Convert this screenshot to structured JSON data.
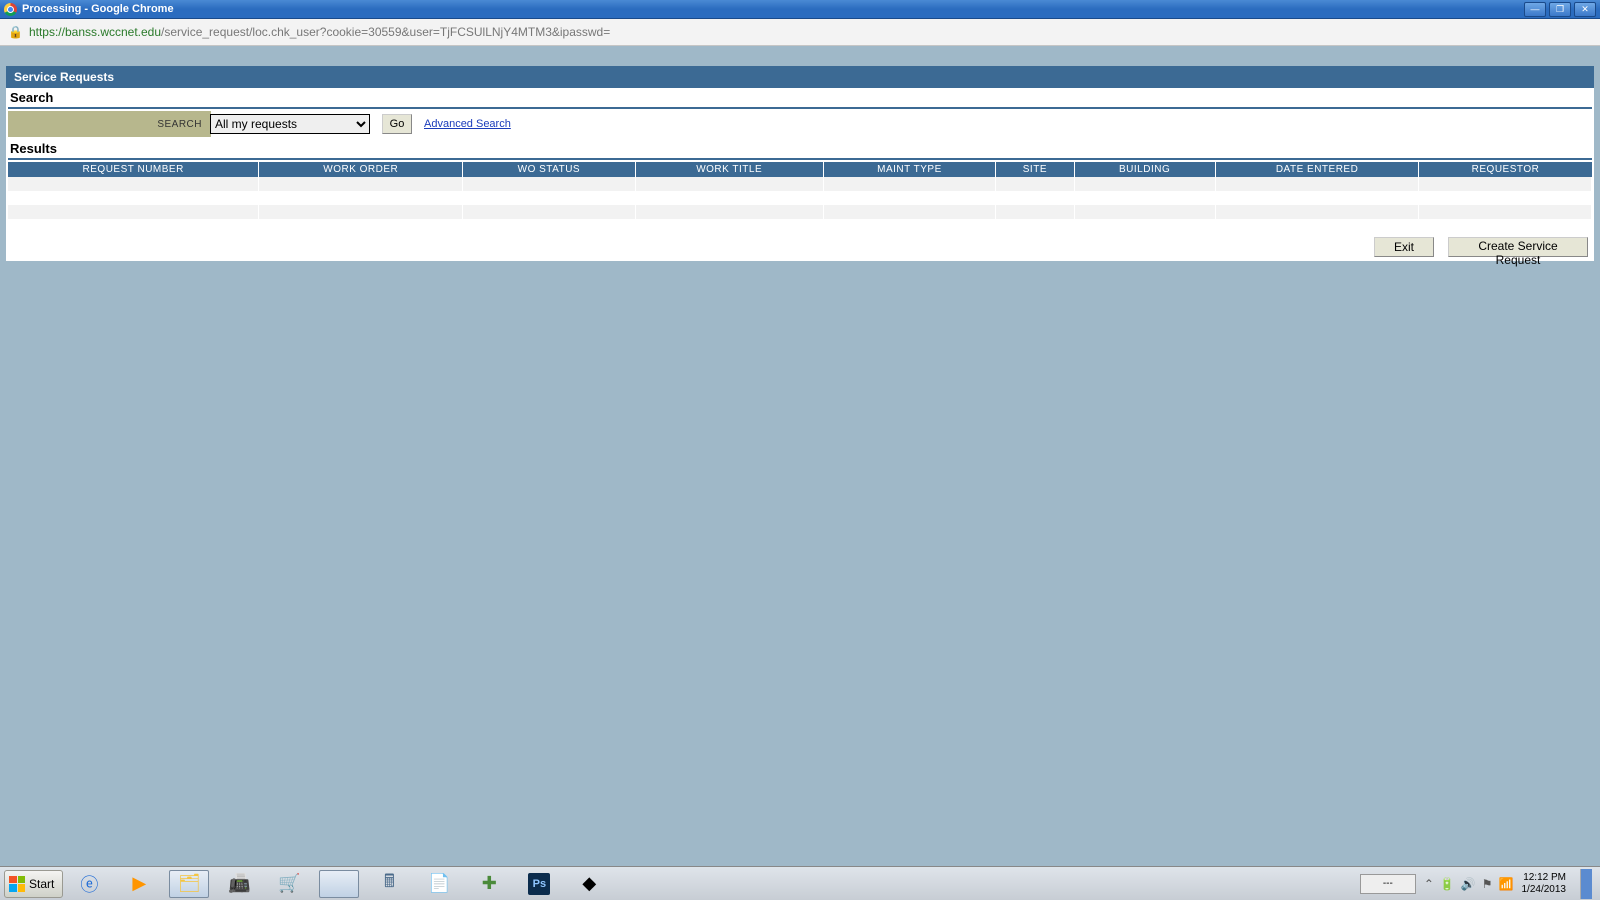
{
  "window": {
    "title": "Processing - Google Chrome"
  },
  "address": {
    "secure_part": "https://banss.wccnet.edu",
    "rest_part": "/service_request/loc.chk_user?cookie=30559&user=TjFCSUlLNjY4MTM3&ipasswd="
  },
  "panel": {
    "header": "Service Requests",
    "search_title": "Search",
    "search_label": "SEARCH",
    "search_selected": "All my requests",
    "go_label": "Go",
    "advanced_label": "Advanced Search",
    "results_title": "Results",
    "columns": [
      "REQUEST NUMBER",
      "WORK ORDER",
      "WO STATUS",
      "WORK TITLE",
      "MAINT TYPE",
      "SITE",
      "BUILDING",
      "DATE ENTERED",
      "REQUESTOR"
    ],
    "exit_label": "Exit",
    "create_label": "Create Service Request"
  },
  "taskbar": {
    "start_label": "Start",
    "lang": "---",
    "time": "12:12 PM",
    "date": "1/24/2013"
  }
}
